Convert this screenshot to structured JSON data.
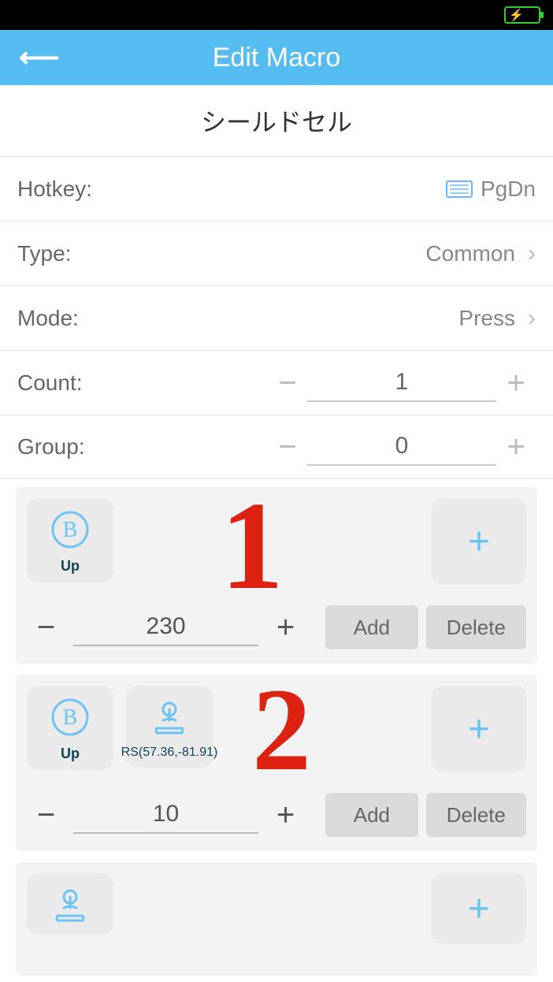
{
  "header": {
    "title": "Edit Macro"
  },
  "macro": {
    "name": "シールドセル",
    "hotkey_label": "Hotkey:",
    "hotkey_value": "PgDn",
    "type_label": "Type:",
    "type_value": "Common",
    "mode_label": "Mode:",
    "mode_value": "Press",
    "count_label": "Count:",
    "count_value": "1",
    "group_label": "Group:",
    "group_value": "0"
  },
  "buttons": {
    "add": "Add",
    "delete": "Delete"
  },
  "steps": [
    {
      "delay": "230",
      "actions": [
        {
          "kind": "b-button",
          "label": "Up"
        }
      ]
    },
    {
      "delay": "10",
      "actions": [
        {
          "kind": "b-button",
          "label": "Up"
        },
        {
          "kind": "joystick",
          "label": "RS(57.36,-81.91)"
        }
      ]
    },
    {
      "delay": "",
      "actions": [
        {
          "kind": "joystick",
          "label": ""
        }
      ]
    }
  ],
  "annotations": [
    "1",
    "2"
  ]
}
